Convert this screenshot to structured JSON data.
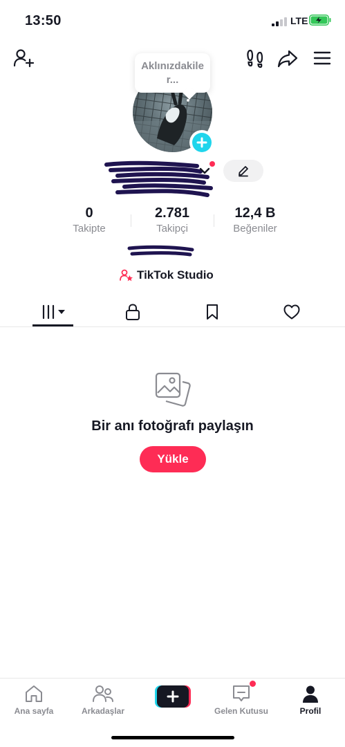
{
  "status_bar": {
    "time": "13:50",
    "network": "LTE",
    "battery_level": 0.9,
    "battery_color": "#34c759"
  },
  "header": {
    "tooltip": "Aklınızdakiler..."
  },
  "profile": {
    "stats": [
      {
        "value": "0",
        "label": "Takipte"
      },
      {
        "value": "2.781",
        "label": "Takipçi"
      },
      {
        "value": "12,4 B",
        "label": "Beğeniler"
      }
    ],
    "studio_label": "TikTok Studio"
  },
  "tabs": [
    {
      "name": "videos",
      "icon": "grid-icon",
      "active": true
    },
    {
      "name": "private",
      "icon": "lock-icon",
      "active": false
    },
    {
      "name": "saved",
      "icon": "bookmark-icon",
      "active": false
    },
    {
      "name": "liked",
      "icon": "heart-icon",
      "active": false
    }
  ],
  "empty_state": {
    "icon": "photos-icon",
    "title": "Bir anı fotoğrafı paylaşın",
    "button_label": "Yükle"
  },
  "bottom_nav": [
    {
      "label": "Ana sayfa",
      "icon": "home-icon"
    },
    {
      "label": "Arkadaşlar",
      "icon": "friends-icon"
    },
    {
      "label": "",
      "icon": "plus-icon"
    },
    {
      "label": "Gelen Kutusu",
      "icon": "inbox-icon",
      "badge": true
    },
    {
      "label": "Profil",
      "icon": "profile-icon",
      "active": true
    }
  ],
  "colors": {
    "accent": "#fe2c55",
    "cyan": "#20d5ec",
    "text": "#161823",
    "muted": "#8a8b91"
  }
}
